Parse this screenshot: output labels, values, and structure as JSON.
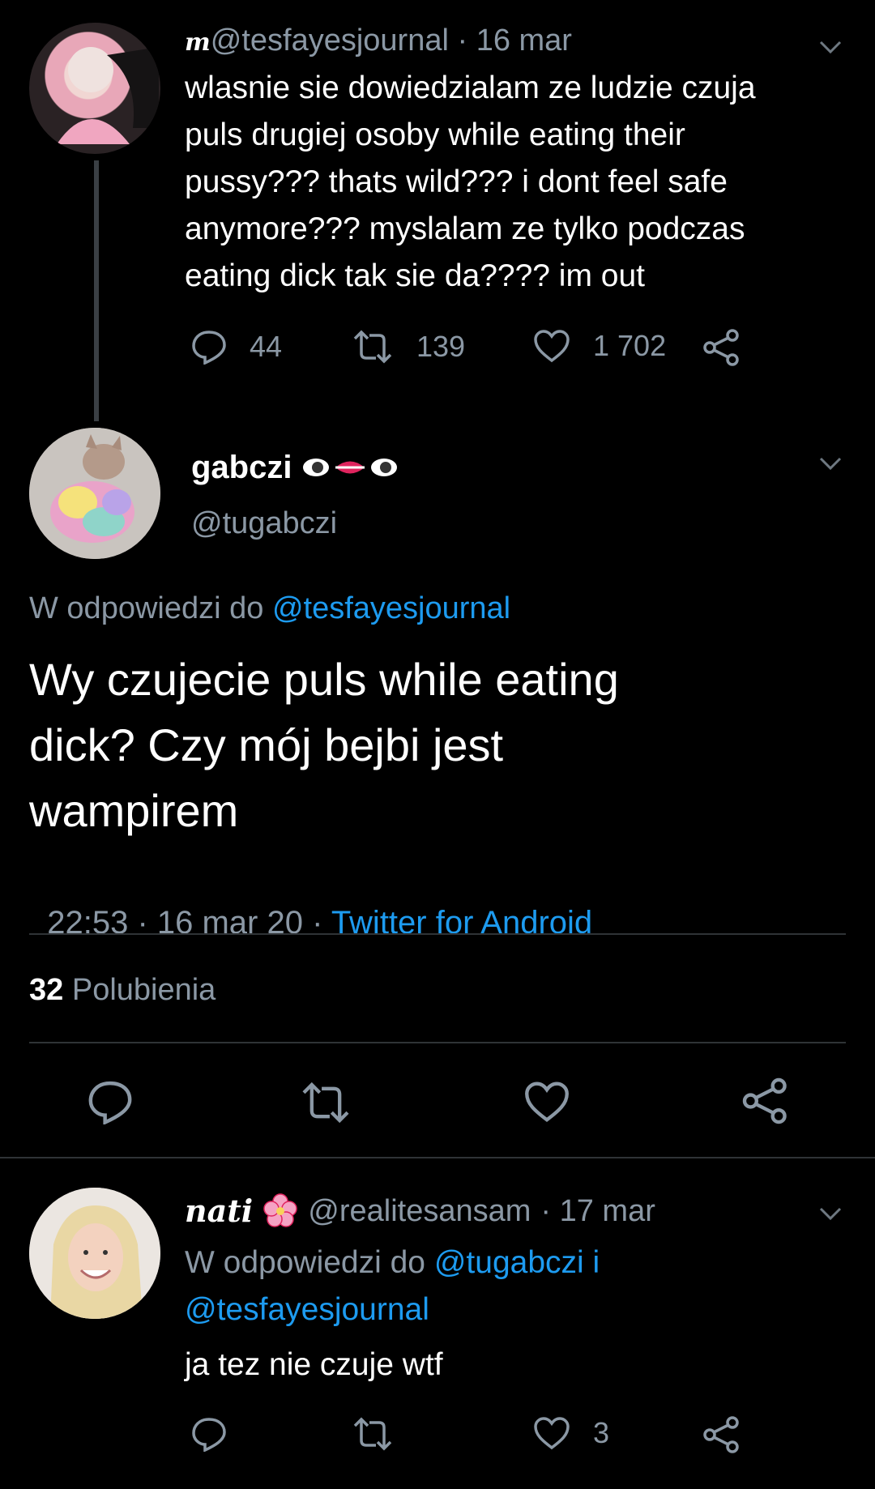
{
  "tweet1": {
    "name_prefix": "m",
    "handle": "@tesfayesjournal",
    "time": "· 16 mar",
    "lines": [
      "wlasnie sie dowiedzialam ze ludzie czuja",
      "puls drugiej osoby while eating their",
      "pussy??? thats wild??? i dont feel safe",
      "anymore??? myslalam ze tylko podczas",
      "eating dick tak sie da???? im out"
    ],
    "replies": "44",
    "retweets": "139",
    "likes": "1 702"
  },
  "tweet2": {
    "name": "gabczi",
    "handle": "@tugabczi",
    "reply_to_label": "W odpowiedzi do",
    "reply_to_handle": "@tesfayesjournal",
    "lines": [
      "Wy czujecie puls while eating",
      "dick? Czy mój bejbi jest",
      "wampirem"
    ],
    "timestamp": "22:53 · 16 mar 20 · ",
    "source": "Twitter for Android",
    "likes_count": "32",
    "likes_label": "Polubienia"
  },
  "tweet3": {
    "name": "nati",
    "handle": "@realitesansam",
    "time": "· 17 mar",
    "reply_to_label": "W odpowiedzi do",
    "reply_to_handle1": "@tugabczi",
    "reply_to_and": "i",
    "reply_to_handle2": "@tesfayesjournal",
    "text": "ja tez nie czuje wtf",
    "likes": "3"
  },
  "icons": [
    "reply-icon",
    "retweet-icon",
    "like-icon",
    "share-icon",
    "chevron-down-icon",
    "eye-icon",
    "lips-icon",
    "blossom-icon"
  ]
}
